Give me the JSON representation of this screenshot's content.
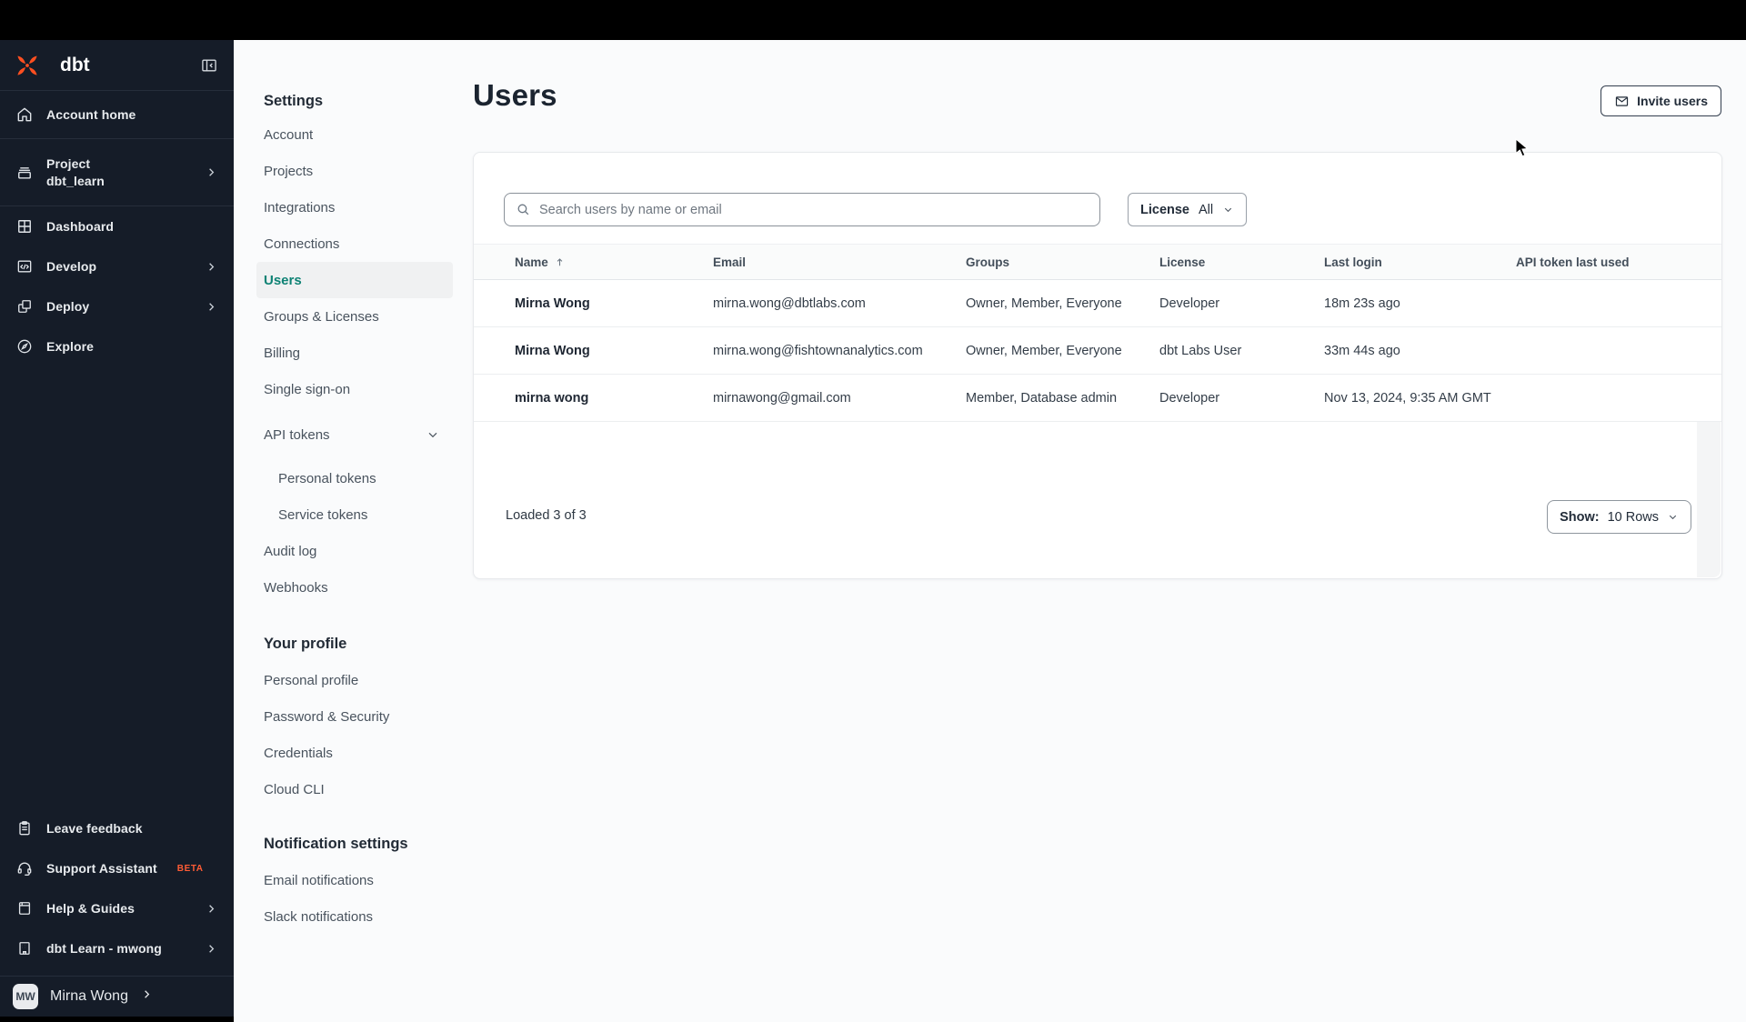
{
  "colors": {
    "accent_orange": "#FF4F20",
    "beta_orange": "#FF5C35",
    "selected_teal": "#0E8274",
    "sidebar_bg": "#151C28",
    "topbar_bg": "#000000",
    "card_bg": "#FFFFFF"
  },
  "sidebar": {
    "logo_text": "dbt",
    "nav": [
      {
        "label": "Account home"
      },
      {
        "label": "Project",
        "sublabel": "dbt_learn"
      },
      {
        "label": "Dashboard"
      },
      {
        "label": "Develop"
      },
      {
        "label": "Deploy"
      },
      {
        "label": "Explore"
      }
    ],
    "bottom": [
      {
        "label": "Leave feedback"
      },
      {
        "label": "Support Assistant",
        "badge": "BETA"
      },
      {
        "label": "Help & Guides"
      },
      {
        "label": "dbt Learn - mwong"
      }
    ],
    "user": {
      "initials": "MW",
      "name": "Mirna Wong"
    }
  },
  "settings_nav": {
    "heading": "Settings",
    "items": [
      {
        "label": "Account"
      },
      {
        "label": "Projects"
      },
      {
        "label": "Integrations"
      },
      {
        "label": "Connections"
      },
      {
        "label": "Users",
        "selected": true
      },
      {
        "label": "Groups & Licenses"
      },
      {
        "label": "Billing"
      },
      {
        "label": "Single sign-on"
      },
      {
        "label": "API tokens"
      },
      {
        "label": "Personal tokens"
      },
      {
        "label": "Service tokens"
      },
      {
        "label": "Audit log"
      },
      {
        "label": "Webhooks"
      }
    ],
    "profile_heading": "Your profile",
    "profile_items": [
      "Personal profile",
      "Password & Security",
      "Credentials",
      "Cloud CLI"
    ],
    "notifications_heading": "Notification settings",
    "notification_items": [
      "Email notifications",
      "Slack notifications"
    ]
  },
  "main": {
    "title": "Users",
    "invite_button": "Invite users",
    "search_placeholder": "Search users by name or email",
    "license_filter": {
      "label": "License",
      "value": "All"
    },
    "table": {
      "columns": [
        "Name",
        "Email",
        "Groups",
        "License",
        "Last login",
        "API token last used"
      ],
      "rows": [
        {
          "name": "Mirna Wong",
          "email": "mirna.wong@dbtlabs.com",
          "groups": "Owner, Member, Everyone",
          "license": "Developer",
          "last_login": "18m 23s ago",
          "api_token_last_used": ""
        },
        {
          "name": "Mirna Wong",
          "email": "mirna.wong@fishtownanalytics.com",
          "groups": "Owner, Member, Everyone",
          "license": "dbt Labs User",
          "last_login": "33m 44s ago",
          "api_token_last_used": ""
        },
        {
          "name": "mirna wong",
          "email": "mirnawong@gmail.com",
          "groups": "Member, Database admin",
          "license": "Developer",
          "last_login": "Nov 13, 2024, 9:35 AM GMT",
          "api_token_last_used": ""
        }
      ]
    },
    "footer": {
      "loaded_text": "Loaded 3 of 3",
      "show_label": "Show:",
      "show_value": "10 Rows"
    }
  }
}
